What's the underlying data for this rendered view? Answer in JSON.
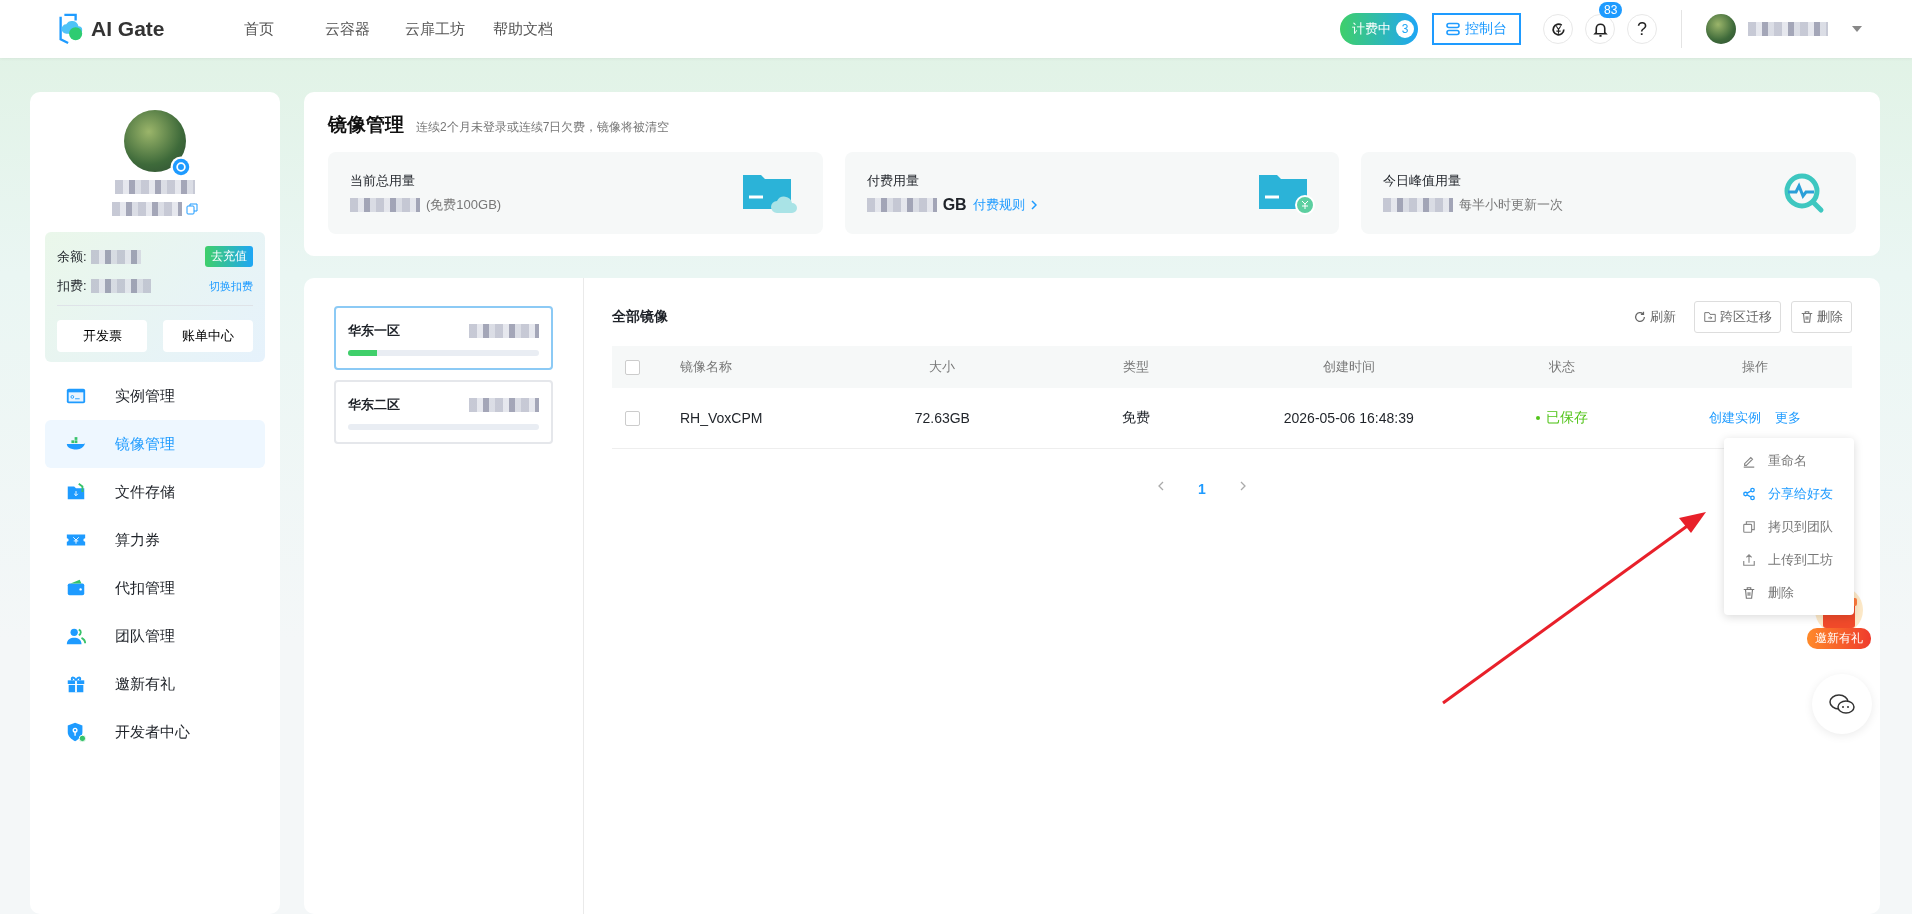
{
  "brand": {
    "name": "AI Gate"
  },
  "nav": [
    {
      "label": "首页",
      "selected": false
    },
    {
      "label": "云容器",
      "selected": false
    },
    {
      "label": "云扉工坊",
      "selected": false
    },
    {
      "label": "帮助文档",
      "selected": false
    }
  ],
  "header": {
    "billing": {
      "label": "计费中",
      "count": "3"
    },
    "console": "控制台",
    "notifications": "83",
    "help": "?"
  },
  "account": {
    "balance_label": "余额:",
    "deduct_label": "扣费:",
    "recharge": "去充值",
    "switch_deduct": "切换扣费",
    "buttons": [
      "开发票",
      "账单中心"
    ]
  },
  "sidebar": {
    "items": [
      {
        "label": "实例管理",
        "selected": false
      },
      {
        "label": "镜像管理",
        "selected": true
      },
      {
        "label": "文件存储",
        "selected": false
      },
      {
        "label": "算力券",
        "selected": false
      },
      {
        "label": "代扣管理",
        "selected": false
      },
      {
        "label": "团队管理",
        "selected": false
      },
      {
        "label": "邀新有礼",
        "selected": false
      },
      {
        "label": "开发者中心",
        "selected": false
      }
    ]
  },
  "page": {
    "title": "镜像管理",
    "subtitle": "连续2个月未登录或连续7日欠费，镜像将被清空"
  },
  "stats": [
    {
      "label": "当前总用量",
      "suffix": "(免费100GB)"
    },
    {
      "label": "付费用量",
      "unit": "GB",
      "link": "付费规则"
    },
    {
      "label": "今日峰值用量",
      "suffix": "每半小时更新一次"
    }
  ],
  "regions": [
    {
      "name": "华东一区",
      "selected": true,
      "level": 0.15
    },
    {
      "name": "华东二区",
      "selected": false,
      "level": 0
    }
  ],
  "table": {
    "title": "全部镜像",
    "select_all_checked": false,
    "actions": [
      {
        "label": "刷新",
        "kind": "link"
      },
      {
        "label": "跨区迁移",
        "kind": "button"
      },
      {
        "label": "删除",
        "kind": "button"
      }
    ],
    "columns": [
      "镜像名称",
      "大小",
      "类型",
      "创建时间",
      "状态",
      "操作"
    ],
    "rows": [
      {
        "checked": false,
        "name": "RH_VoxCPM",
        "size": "72.63GB",
        "type": "免费",
        "created": "2026-05-06 16:48:39",
        "status": {
          "text": "已保存",
          "kind": "saved"
        },
        "operations": [
          "创建实例",
          "更多"
        ]
      }
    ]
  },
  "pagination": {
    "pages": [
      {
        "label": "1",
        "selected": true
      }
    ]
  },
  "menu": {
    "items": [
      {
        "label": "重命名",
        "selected": false
      },
      {
        "label": "分享给好友",
        "selected": true
      },
      {
        "label": "拷贝到团队",
        "selected": false
      },
      {
        "label": "上传到工坊",
        "selected": false
      },
      {
        "label": "删除",
        "selected": false
      }
    ]
  },
  "promo": {
    "label": "邀新有礼"
  }
}
